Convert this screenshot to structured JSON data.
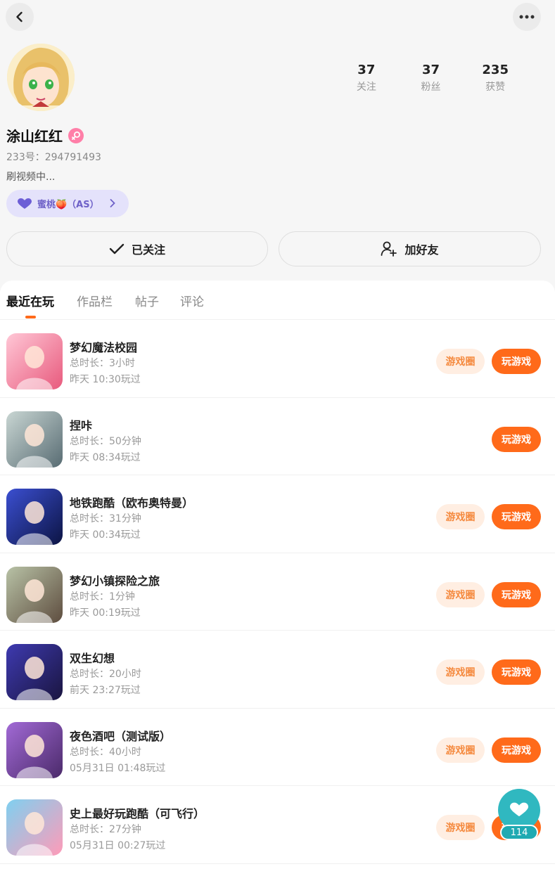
{
  "header": {
    "back_icon": "chevron-left-icon",
    "more_icon": "ellipsis-icon"
  },
  "profile": {
    "name": "涂山红红",
    "uid": "233号：294791493",
    "bio": "刷视频中...",
    "tag": "蜜桃🍑（AS）",
    "stats": [
      {
        "num": "37",
        "label": "关注"
      },
      {
        "num": "37",
        "label": "粉丝"
      },
      {
        "num": "235",
        "label": "获赞"
      }
    ],
    "follow_label": "已关注",
    "add_friend_label": "加好友"
  },
  "tabs": [
    {
      "label": "最近在玩"
    },
    {
      "label": "作品栏"
    },
    {
      "label": "帖子"
    },
    {
      "label": "评论"
    }
  ],
  "games": [
    {
      "title": "梦幻魔法校园",
      "duration": "总时长：3小时",
      "last": "昨天 10:30玩过",
      "circle": "游戏圈",
      "play": "玩游戏",
      "c1": "#ffc7d6",
      "c2": "#e85a7d"
    },
    {
      "title": "捏咔",
      "duration": "总时长：50分钟",
      "last": "昨天 08:34玩过",
      "circle": "",
      "play": "玩游戏",
      "c1": "#c9d6d3",
      "c2": "#586c73"
    },
    {
      "title": "地铁跑酷（欧布奥特曼）",
      "duration": "总时长：31分钟",
      "last": "昨天 00:34玩过",
      "circle": "游戏圈",
      "play": "玩游戏",
      "c1": "#3b4fd1",
      "c2": "#0c1444"
    },
    {
      "title": "梦幻小镇探险之旅",
      "duration": "总时长：1分钟",
      "last": "昨天 00:19玩过",
      "circle": "游戏圈",
      "play": "玩游戏",
      "c1": "#b8c2a6",
      "c2": "#5e4d3f"
    },
    {
      "title": "双生幻想",
      "duration": "总时长：20小时",
      "last": "前天 23:27玩过",
      "circle": "游戏圈",
      "play": "玩游戏",
      "c1": "#3e3ab0",
      "c2": "#1a1540"
    },
    {
      "title": "夜色酒吧（测试版）",
      "duration": "总时长：40小时",
      "last": "05月31日 01:48玩过",
      "circle": "游戏圈",
      "play": "玩游戏",
      "c1": "#a26ad6",
      "c2": "#4b2a6a"
    },
    {
      "title": "史上最好玩跑酷（可飞行）",
      "duration": "总时长：27分钟",
      "last": "05月31日 00:27玩过",
      "circle": "游戏圈",
      "play": "玩游戏",
      "c1": "#7fd0f0",
      "c2": "#ff9bb8"
    }
  ],
  "fab": {
    "icon": "heart-icon",
    "count": "114"
  }
}
